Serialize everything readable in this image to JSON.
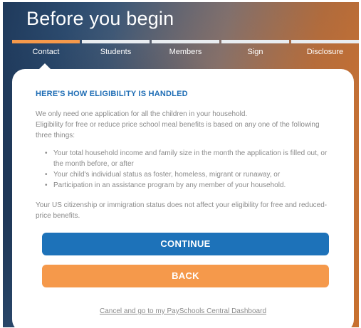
{
  "header": {
    "title": "Before you begin"
  },
  "steps": [
    {
      "label": "Contact",
      "active": true
    },
    {
      "label": "Students",
      "active": false
    },
    {
      "label": "Members",
      "active": false
    },
    {
      "label": "Sign",
      "active": false
    },
    {
      "label": "Disclosure",
      "active": false
    }
  ],
  "card": {
    "heading": "HERE'S HOW ELIGIBILITY IS HANDLED",
    "intro_line1": "We only need one application for all the children in your household.",
    "intro_line2": "Eligibility for free or reduce price school meal benefits is based on any one of the following three things:",
    "bullets": [
      "Your total household income and family size in the month the application is filled out, or the month before, or after",
      "Your child's individual status as foster, homeless, migrant or runaway, or",
      "Participation in an assistance program by any member of your household."
    ],
    "notice": "Your US citizenship or immigration status does not affect your eligibility for free and reduced-price benefits."
  },
  "buttons": {
    "continue_label": "CONTINUE",
    "back_label": "BACK"
  },
  "footer": {
    "cancel_link": "Cancel and go to my PaySchools Central Dashboard"
  },
  "colors": {
    "accent_blue": "#1d72b9",
    "accent_orange": "#f5994b",
    "heading_blue": "#1e6db5",
    "body_text": "#8a8a8a"
  }
}
